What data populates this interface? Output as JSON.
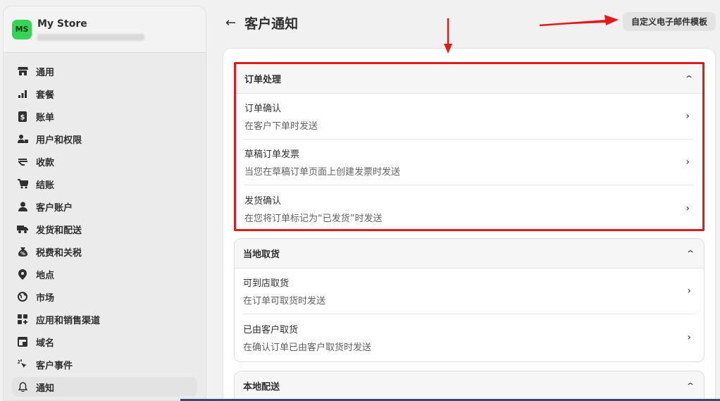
{
  "sidebar": {
    "store": {
      "initials": "MS",
      "name": "My Store"
    },
    "items": [
      {
        "label": "通用",
        "icon": "store-icon"
      },
      {
        "label": "套餐",
        "icon": "chart-icon"
      },
      {
        "label": "账单",
        "icon": "dollar-icon"
      },
      {
        "label": "用户和权限",
        "icon": "users-icon"
      },
      {
        "label": "收款",
        "icon": "payments-icon"
      },
      {
        "label": "结账",
        "icon": "cart-icon"
      },
      {
        "label": "客户账户",
        "icon": "person-icon"
      },
      {
        "label": "发货和配送",
        "icon": "truck-icon"
      },
      {
        "label": "税费和关税",
        "icon": "tax-icon"
      },
      {
        "label": "地点",
        "icon": "location-icon"
      },
      {
        "label": "市场",
        "icon": "globe-icon"
      },
      {
        "label": "应用和销售渠道",
        "icon": "apps-icon"
      },
      {
        "label": "域名",
        "icon": "domain-icon"
      },
      {
        "label": "客户事件",
        "icon": "cursor-icon"
      },
      {
        "label": "通知",
        "icon": "bell-icon"
      }
    ]
  },
  "header": {
    "title": "客户通知",
    "custom_template_button": "自定义电子邮件模板"
  },
  "sections": [
    {
      "title": "订单处理",
      "rows": [
        {
          "title": "订单确认",
          "desc": "在客户下单时发送"
        },
        {
          "title": "草稿订单发票",
          "desc": "当您在草稿订单页面上创建发票时发送"
        },
        {
          "title": "发货确认",
          "desc": "在您将订单标记为“已发货”时发送"
        }
      ]
    },
    {
      "title": "当地取货",
      "rows": [
        {
          "title": "可到店取货",
          "desc": "在订单可取货时发送"
        },
        {
          "title": "已由客户取货",
          "desc": "在确认订单已由客户取货时发送"
        }
      ]
    },
    {
      "title": "本地配送",
      "rows": []
    }
  ],
  "colors": {
    "avatar": "#36d454",
    "highlight": "#e11b1b",
    "annotation_arrow": "#e11b1b"
  }
}
